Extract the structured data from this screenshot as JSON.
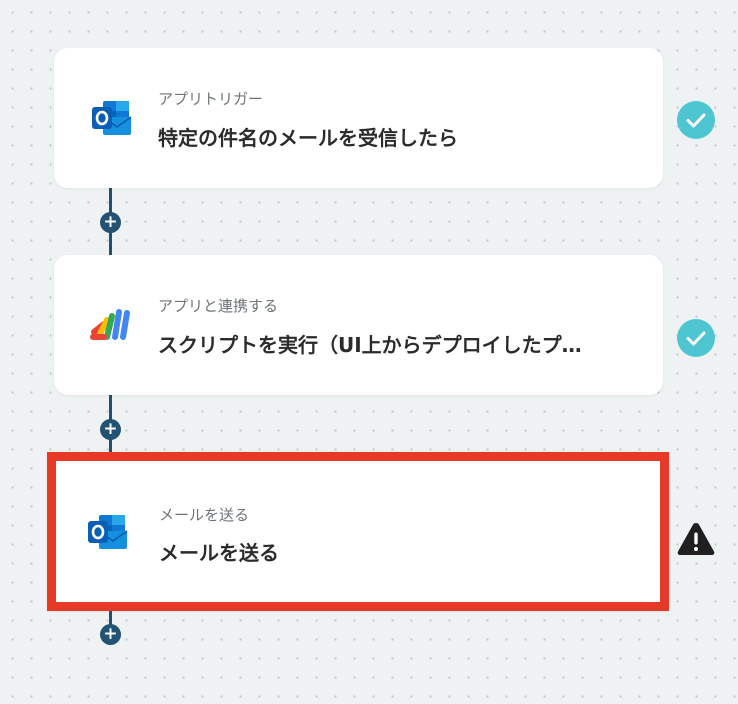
{
  "steps": [
    {
      "app_icon": "outlook-icon",
      "label": "アプリトリガー",
      "title": "特定の件名のメールを受信したら",
      "status": "completed"
    },
    {
      "app_icon": "google-apps-script-icon",
      "label": "アプリと連携する",
      "title": "スクリプトを実行（UI上からデプロイしたプ…",
      "status": "completed"
    },
    {
      "app_icon": "outlook-icon",
      "label": "メールを送る",
      "title": "メールを送る",
      "status": "warning"
    }
  ],
  "add_step_symbol": "+",
  "colors": {
    "connector": "#1f5070",
    "check_badge": "#4dc6d2",
    "selected_border": "#e63a27",
    "warning": "#1f1f1f"
  }
}
